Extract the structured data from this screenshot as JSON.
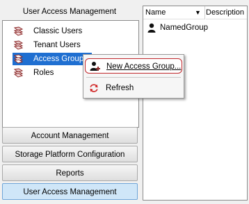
{
  "left_panel": {
    "title": "User Access Management",
    "tree": [
      {
        "label": "Classic Users",
        "icon": "roles-icon"
      },
      {
        "label": "Tenant Users",
        "icon": "roles-icon"
      },
      {
        "label": "Access Groups",
        "icon": "roles-icon",
        "selected": true
      },
      {
        "label": "Roles",
        "icon": "roles-icon"
      }
    ]
  },
  "nav_buttons": [
    {
      "label": "Account Management"
    },
    {
      "label": "Storage Platform Configuration"
    },
    {
      "label": "Reports"
    },
    {
      "label": "User Access Management",
      "active": true
    }
  ],
  "table": {
    "columns": {
      "name": "Name",
      "description": "Description"
    },
    "sort_indicator": "▼",
    "rows": [
      {
        "name": "NamedGroup",
        "description": ""
      }
    ]
  },
  "context_menu": {
    "items": [
      {
        "label": "New Access Group...",
        "icon": "add-user-icon",
        "highlighted": true
      },
      {
        "label": "Refresh",
        "icon": "refresh-icon"
      }
    ]
  },
  "colors": {
    "selection": "#1f6fd1",
    "highlight_border": "#c0262b",
    "active_button": "#cfe6f8"
  }
}
